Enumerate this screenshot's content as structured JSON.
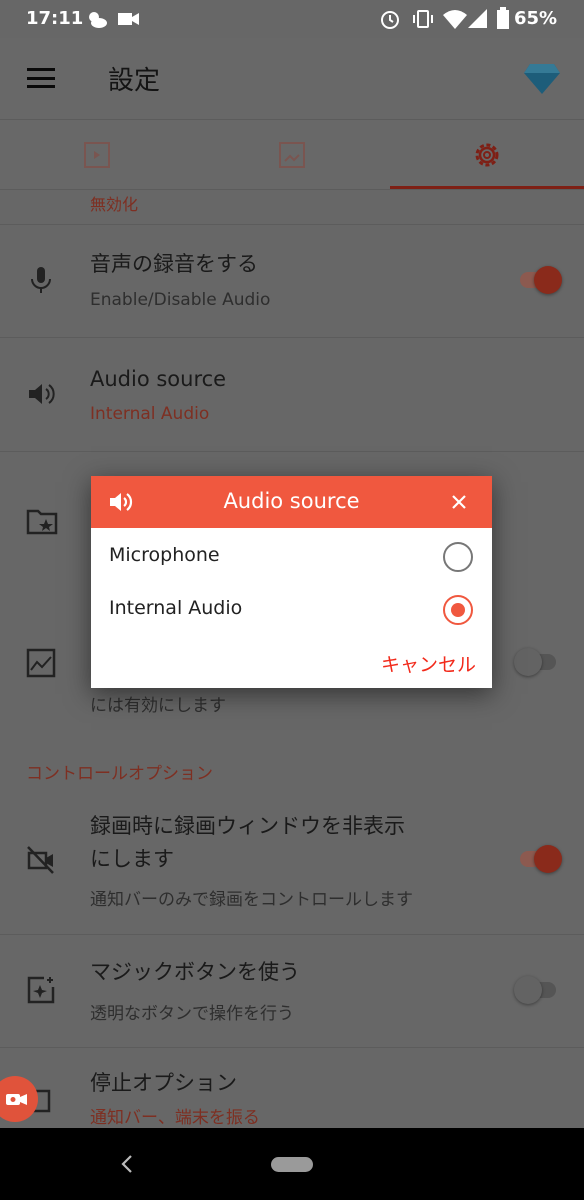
{
  "status_bar": {
    "time": "17:11",
    "battery": "65%",
    "icons": [
      "weather-icon",
      "video-camera-icon",
      "alarm-icon",
      "vibrate-icon",
      "wifi-icon",
      "signal-icon",
      "battery-icon"
    ]
  },
  "app_bar": {
    "title": "設定",
    "menu_icon": "hamburger-icon",
    "premium_icon": "diamond-icon"
  },
  "tabs": [
    {
      "icon": "video-icon",
      "active": false
    },
    {
      "icon": "image-icon",
      "active": false
    },
    {
      "icon": "gear-icon",
      "active": true
    }
  ],
  "settings": {
    "partial_top": "無効化",
    "audio_record": {
      "title": "音声の録音をする",
      "subtitle": "Enable/Disable Audio",
      "enabled": true
    },
    "audio_source": {
      "title": "Audio source",
      "value": "Internal Audio"
    },
    "image_row": {
      "subtitle_tail": "には有効にします",
      "enabled": false
    },
    "section_control": "コントロールオプション",
    "hide_window": {
      "title_line1": "録画時に録画ウィンドウを非表示",
      "title_line2": "にします",
      "subtitle": "通知バーのみで録画をコントロールします",
      "enabled": true
    },
    "magic_button": {
      "title": "マジックボタンを使う",
      "subtitle": "透明なボタンで操作を行う",
      "enabled": false
    },
    "stop_option": {
      "title": "停止オプション",
      "value": "通知バー、端末を振る"
    }
  },
  "dialog": {
    "title": "Audio source",
    "options": [
      {
        "label": "Microphone",
        "selected": false
      },
      {
        "label": "Internal Audio",
        "selected": true
      }
    ],
    "cancel": "キャンセル",
    "accent": "#f0583f"
  }
}
